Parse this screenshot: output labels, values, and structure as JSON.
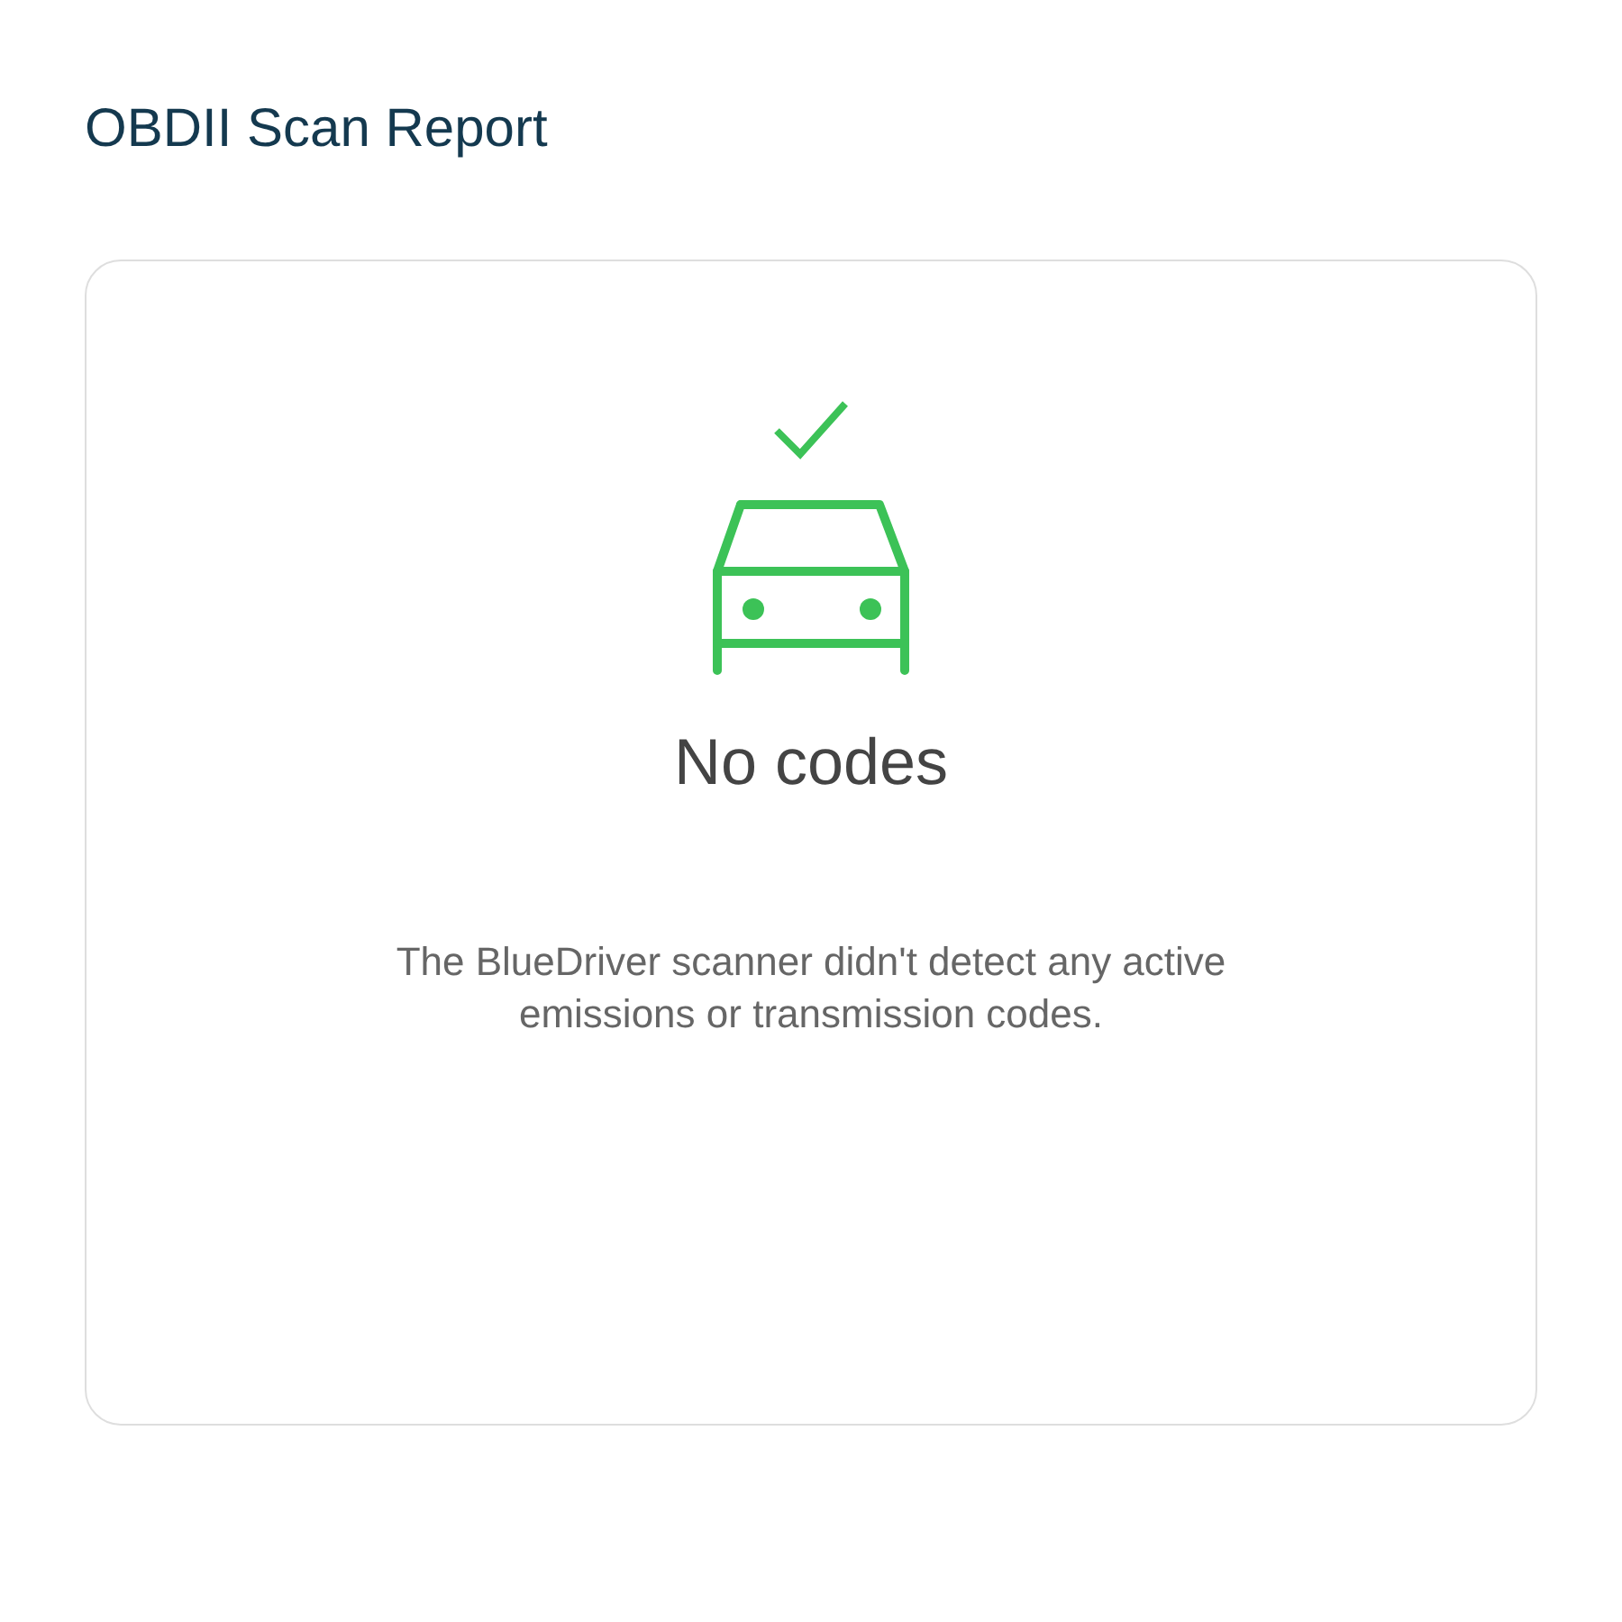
{
  "header": {
    "title": "OBDII Scan Report"
  },
  "result": {
    "headline": "No codes",
    "message": "The BlueDriver scanner didn't detect any active emissions or transmission codes."
  }
}
